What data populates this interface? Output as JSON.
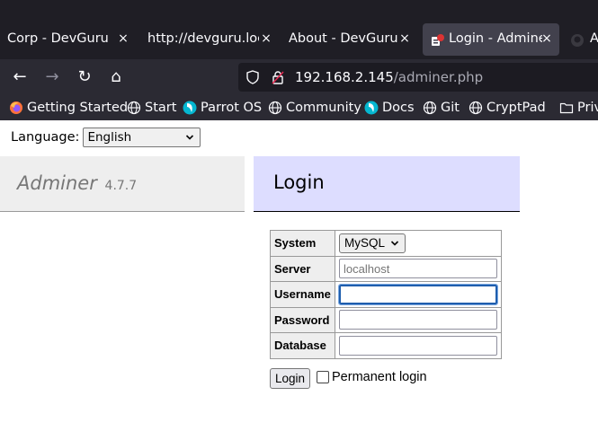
{
  "tabs": [
    {
      "title": "Corp - DevGuru",
      "close": "×"
    },
    {
      "title": "http://devguru.loca",
      "close": "×"
    },
    {
      "title": "About - DevGuru",
      "close": "×"
    },
    {
      "title": "Login - Adminer",
      "close": "×",
      "active": true
    },
    {
      "title": "A",
      "close": ""
    }
  ],
  "nav": {
    "back_icon": "←",
    "forward_icon": "→",
    "reload_icon": "↻",
    "home_icon": "⌂"
  },
  "url": {
    "host": "192.168.2.145",
    "path": "/adminer.php"
  },
  "bookmarks": [
    {
      "label": "Getting Started",
      "icon": "firefox-icon"
    },
    {
      "label": "Start",
      "icon": "globe-icon"
    },
    {
      "label": "Parrot OS",
      "icon": "parrot-icon"
    },
    {
      "label": "Community",
      "icon": "globe-icon"
    },
    {
      "label": "Docs",
      "icon": "parrot-icon"
    },
    {
      "label": "Git",
      "icon": "globe-icon"
    },
    {
      "label": "CryptPad",
      "icon": "globe-icon"
    },
    {
      "label": "Priv",
      "icon": "folder-icon"
    }
  ],
  "page": {
    "language_label": "Language:",
    "language_value": "English",
    "app_name": "Adminer",
    "app_version": "4.7.7",
    "heading": "Login",
    "form": {
      "system_label": "System",
      "system_value": "MySQL",
      "server_label": "Server",
      "server_placeholder": "localhost",
      "username_label": "Username",
      "username_value": "",
      "password_label": "Password",
      "password_value": "",
      "database_label": "Database",
      "database_value": "",
      "submit_label": "Login",
      "permanent_label": "Permanent login"
    }
  },
  "colors": {
    "tabstrip_bg": "#1f1e25",
    "toolbar_bg": "#2b2a33",
    "login_header_bg": "#ddddff",
    "adminer_header_bg": "#eeeeee"
  }
}
